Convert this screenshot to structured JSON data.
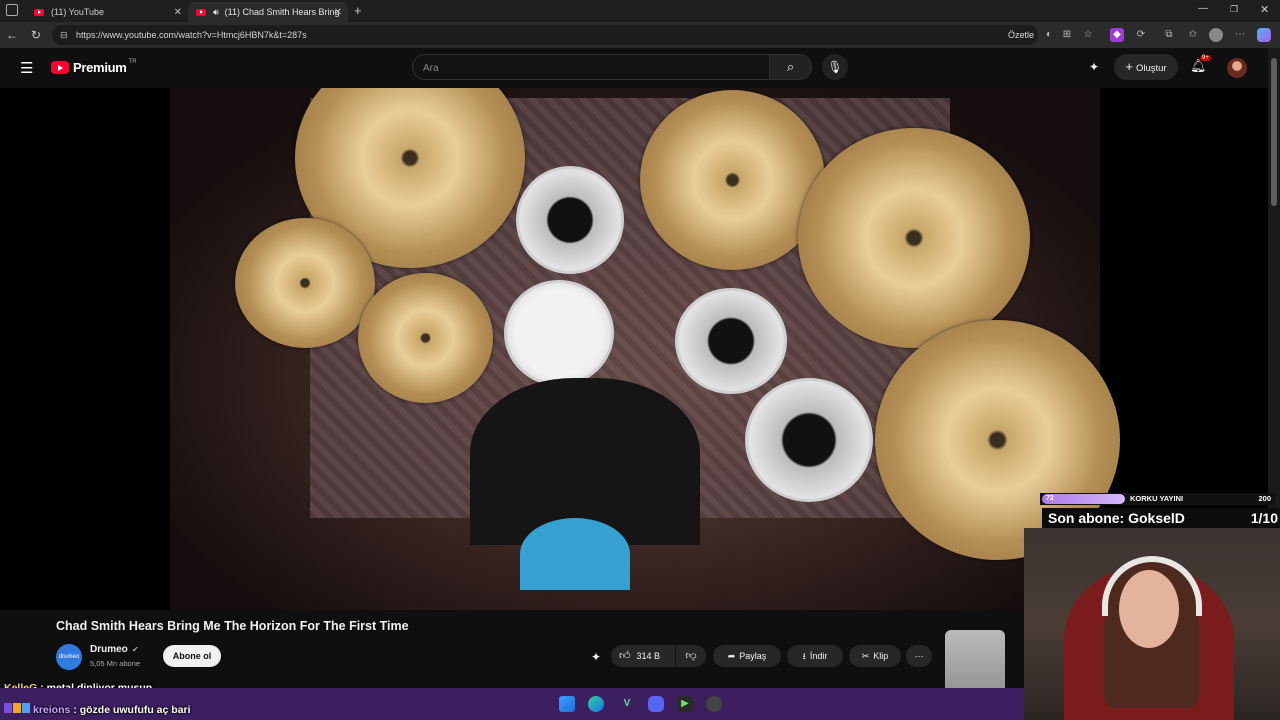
{
  "browser": {
    "tabs": [
      {
        "label": "(11) YouTube"
      },
      {
        "label": "(11) Chad Smith Hears Bring"
      }
    ],
    "url": "https://www.youtube.com/watch?v=Htmcj6HBN7k&t=287s",
    "summarize_label": "Özetle"
  },
  "youtube": {
    "logo_text": "Premium",
    "logo_region": "TR",
    "search_placeholder": "Ara",
    "create_label": "Oluştur",
    "notification_count": "9+"
  },
  "video": {
    "title": "Chad Smith Hears Bring Me The Horizon For The First Time",
    "channel": {
      "name": "Drumeo",
      "subscribers": "5,05 Mn abone",
      "logo_text": "drumeo"
    },
    "subscribe_label": "Abone ol",
    "likes": "314 B",
    "share_label": "Paylaş",
    "download_label": "İndir",
    "clip_label": "Klip"
  },
  "stream_overlay": {
    "goal_label": "KORKU YAYINI",
    "goal_current": "72",
    "goal_target": "200",
    "goal_progress": 0.36,
    "last_sub": "Son abone: GokselD",
    "sub_count": "1/10"
  },
  "chat": [
    {
      "user": "KelleG",
      "message": "metal dinliyor musun"
    },
    {
      "user": "kreions",
      "message": "gözde uwufufu aç bari"
    }
  ],
  "colors": {
    "youtube_red": "#ff0033",
    "overlay_purple": "#b07ae8",
    "taskbar": "#3b1f5e"
  }
}
